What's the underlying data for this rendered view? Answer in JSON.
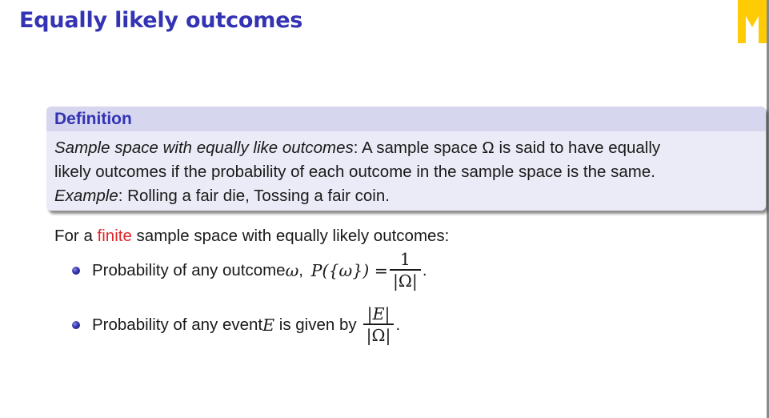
{
  "frame_title": "Equally likely outcomes",
  "definition": {
    "heading": "Definition",
    "term": "Sample space with equally like outcomes",
    "body_line1": ": A sample space Ω is said to have equally",
    "body_line2": "likely outcomes if the probability of each outcome in the sample space is the same.",
    "example_label": "Example",
    "example_text": ": Rolling a fair die, Tossing a fair coin."
  },
  "lead": {
    "before": "For a ",
    "highlight": "finite",
    "after": " sample space with equally likely outcomes:"
  },
  "bullets": [
    {
      "text": "Probability of any outcome ",
      "var": "ω",
      "sep": ", ",
      "expr": "P({ω}) =",
      "numerator": "1",
      "denominator": "|Ω|",
      "end": "."
    },
    {
      "text": "Probability of any event ",
      "var": "E",
      "text2": " is given by",
      "numerator": "|E|",
      "denominator": "|Ω|",
      "end": "."
    }
  ],
  "colors": {
    "title": "#3333b3",
    "highlight": "#e0262a",
    "logo": "#ffcb05"
  }
}
